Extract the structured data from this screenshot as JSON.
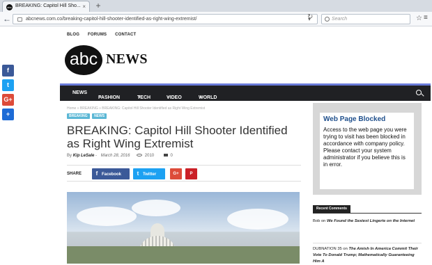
{
  "browser": {
    "tab_title": "BREAKING: Capitol Hill Sho...",
    "tab_close": "×",
    "new_tab": "+",
    "address": "abcnews.com.co/breaking-capitol-hill-shooter-identified-as-right-wing-extremist/",
    "search_placeholder": "Search",
    "icons": [
      "back-icon",
      "lock-icon",
      "dropdown-icon",
      "reload-icon",
      "search-icon",
      "star-icon",
      "menu-icon"
    ]
  },
  "share_sidebar": {
    "items": [
      "f",
      "t",
      "G+",
      "+"
    ]
  },
  "site": {
    "top_links": [
      "BLOG",
      "FORUMS",
      "CONTACT"
    ],
    "logo_circle": "abc",
    "logo_text": "NEWS",
    "nav": [
      "NEWS",
      "FASHION",
      "TECH",
      "VIDEO",
      "WORLD"
    ]
  },
  "article": {
    "breadcrumb": "Home  »  BREAKING  »  BREAKING: Capitol Hill Shooter Identified as Right Wing Extremist",
    "tags": [
      "BREAKING",
      "NEWS"
    ],
    "title": "BREAKING: Capitol Hill Shooter Identified as Right Wing Extremist",
    "author_prefix": "By",
    "author": "Kip LeSale",
    "date": "March 28, 2016",
    "views": "2010",
    "comments": "0",
    "share_label": "SHARE",
    "share_buttons": {
      "facebook": "Facebook",
      "twitter": "Twitter",
      "google": "G+",
      "pinterest": "P"
    }
  },
  "sidebar": {
    "blocked_title": "Web Page Blocked",
    "blocked_text": "Access to the web page you were trying to visit has been blocked in accordance with company policy. Please contact your system administrator if you believe this is in error.",
    "recent_comments_title": "Recent Comments",
    "comments": [
      {
        "author": "Bob",
        "on": "on",
        "post": "We Found the Sexiest Lingerie on the Internet"
      },
      {
        "author": "DUBNATION 35",
        "on": "on",
        "post": "The Amish In America Commit Their Vote To Donald Trump; Mathematically Guaranteeing Him A"
      }
    ]
  }
}
